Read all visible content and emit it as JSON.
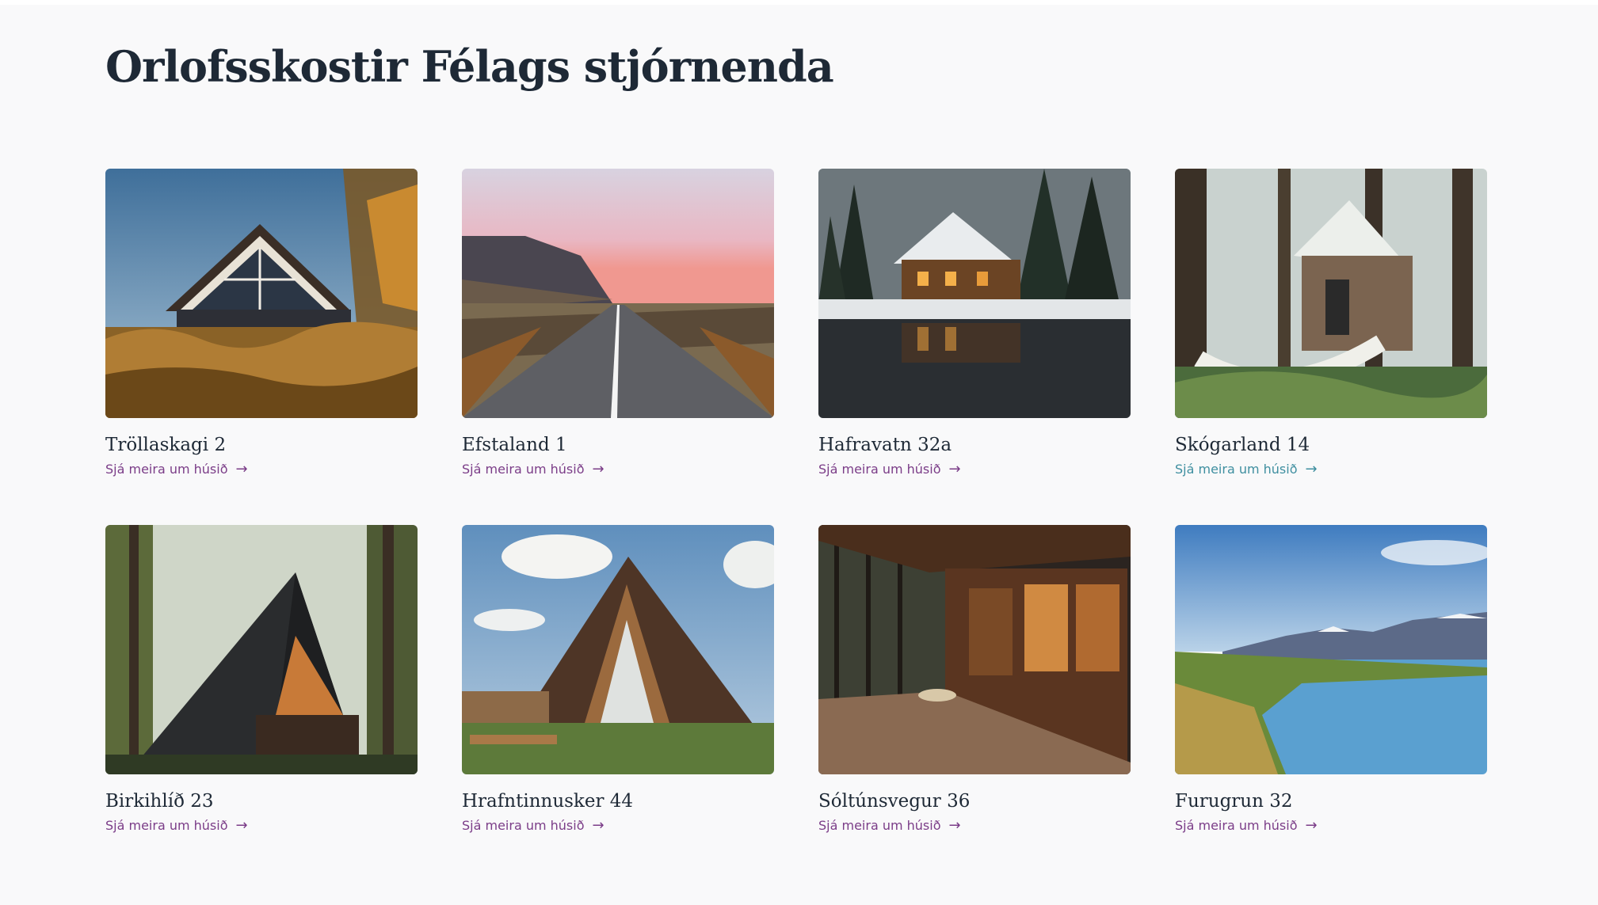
{
  "page": {
    "title": "Orlofsskostir Félags stjórnenda"
  },
  "colors": {
    "background": "#f9f9fa",
    "title": "#1e2936",
    "link": "#7b3d88",
    "link_hover": "#3f8fa0"
  },
  "cards": [
    {
      "name": "Tröllaskagi 2",
      "link": "Sjá meira um húsið",
      "arrow": "→",
      "image": "a-frame-cabin-glass-facade-dusk"
    },
    {
      "name": "Efstaland 1",
      "link": "Sjá meira um húsið",
      "arrow": "→",
      "image": "road-to-cliffs-pink-sunset"
    },
    {
      "name": "Hafravatn 32a",
      "link": "Sjá meira um húsið",
      "arrow": "→",
      "image": "log-cabin-snow-lake-reflection"
    },
    {
      "name": "Skógarland 14",
      "link": "Sjá meira um húsið",
      "arrow": "→",
      "image": "forest-cabin-with-hammock"
    },
    {
      "name": "Birkihlíð 23",
      "link": "Sjá meira um húsið",
      "arrow": "→",
      "image": "black-a-frame-cabin-forest"
    },
    {
      "name": "Hrafntinnusker 44",
      "link": "Sjá meira um húsið",
      "arrow": "→",
      "image": "brown-a-frame-house-meadow"
    },
    {
      "name": "Sóltúnsvegur 36",
      "link": "Sjá meira um húsið",
      "arrow": "→",
      "image": "cabin-porch-evening-lights"
    },
    {
      "name": "Furugrun 32",
      "link": "Sjá meira um húsið",
      "arrow": "→",
      "image": "fjord-mountain-landscape"
    }
  ]
}
